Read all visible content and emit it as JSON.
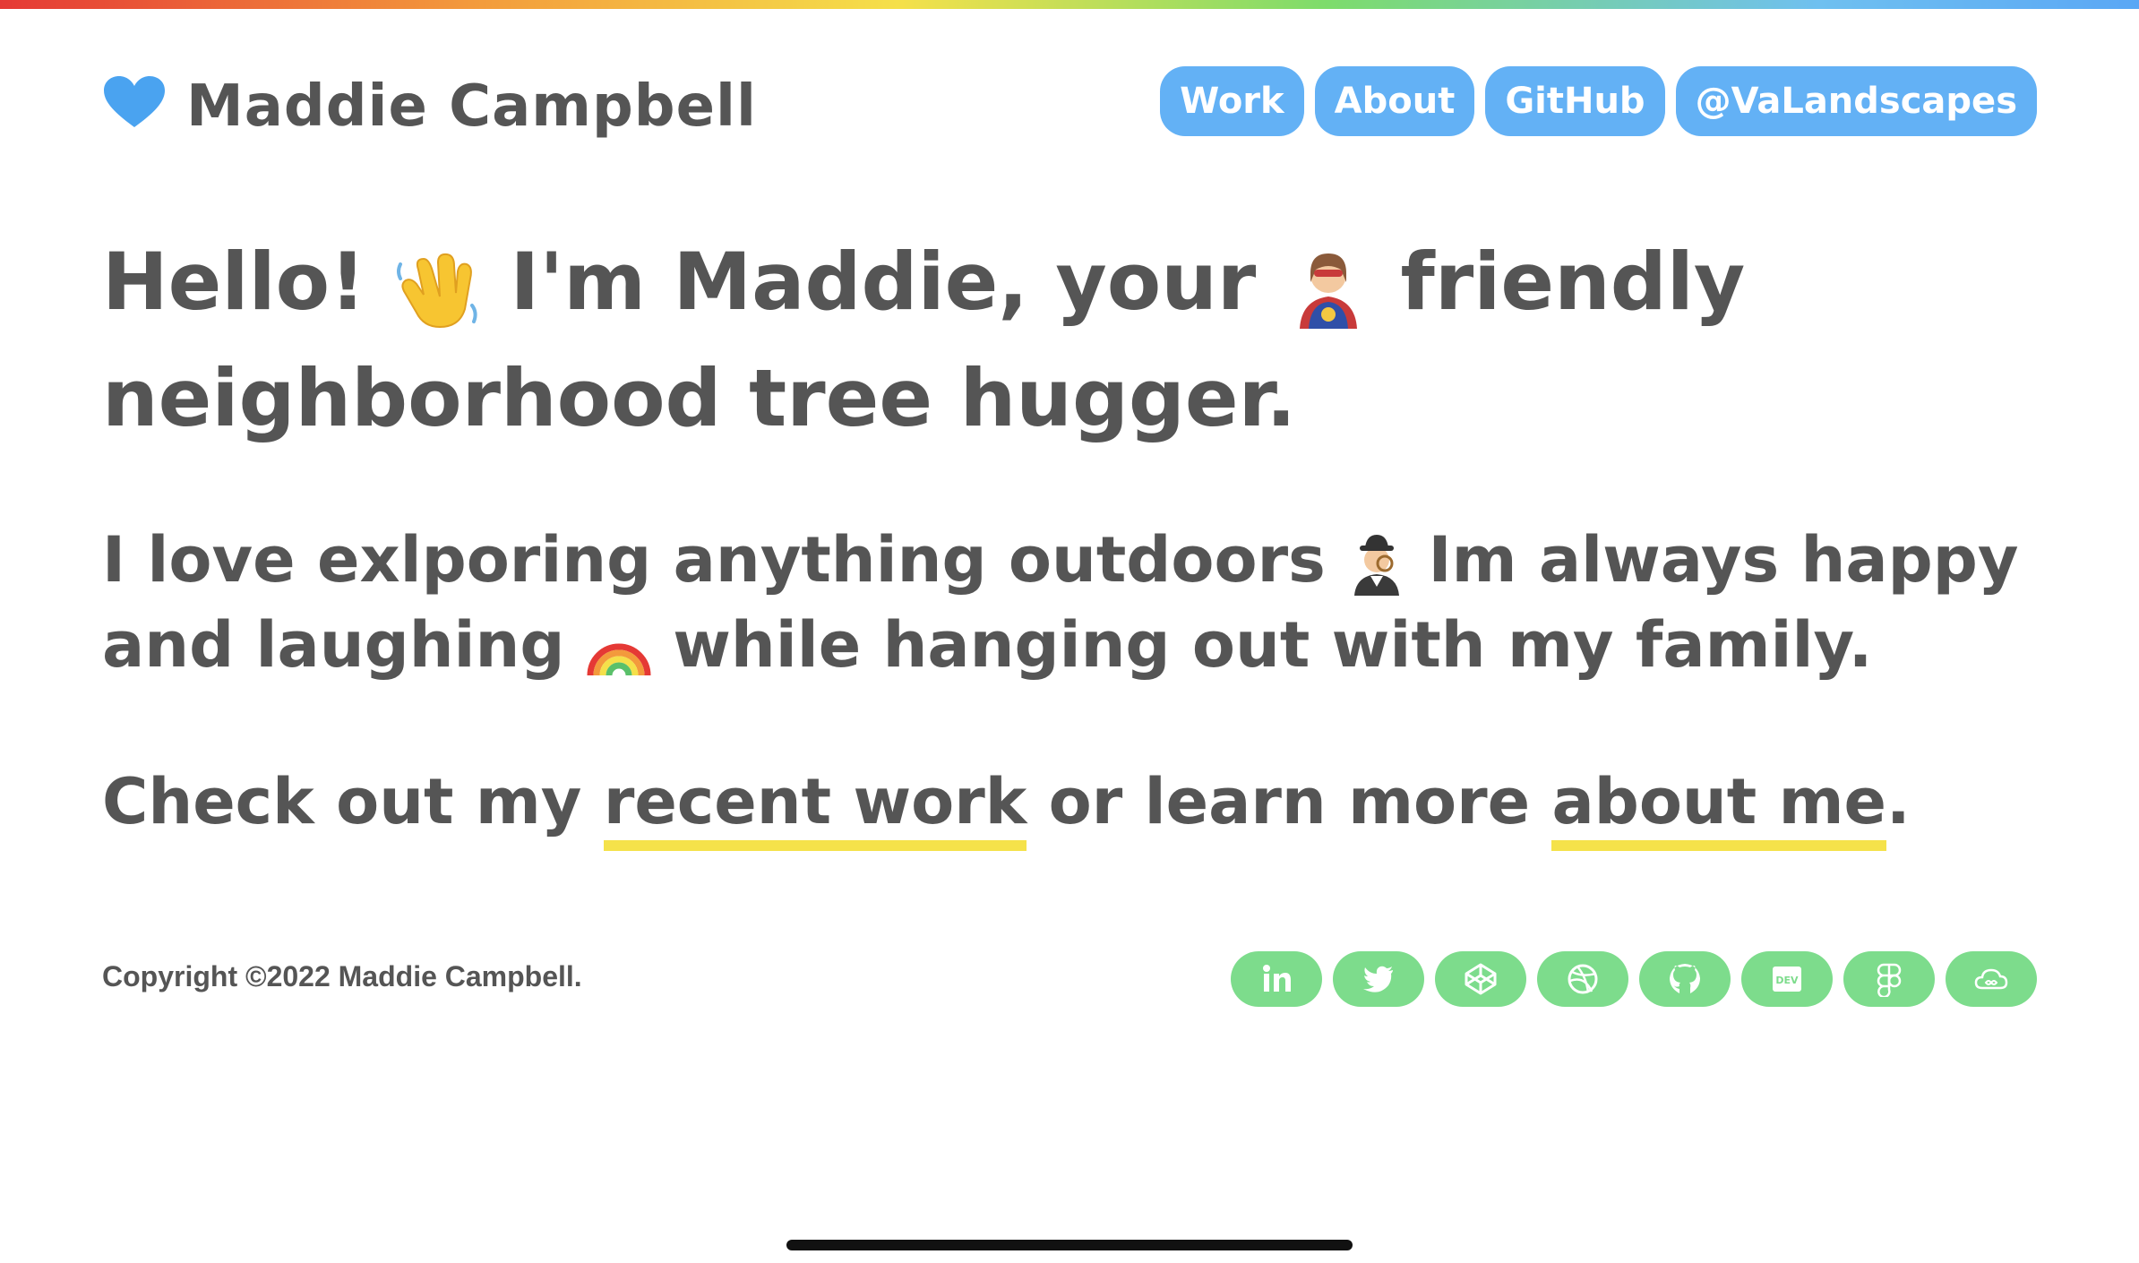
{
  "brand": {
    "name": "Maddie Campbell",
    "icon": "blue-heart-icon",
    "icon_color": "#4aa3f0"
  },
  "nav": {
    "items": [
      {
        "label": "Work"
      },
      {
        "label": "About"
      },
      {
        "label": "GitHub"
      },
      {
        "label": "@VaLandscapes"
      }
    ],
    "pill_color": "#63b1f5"
  },
  "hero": {
    "part1": "Hello!",
    "part2": "I'm Maddie, your",
    "part3": "friendly neighborhood tree hugger.",
    "emoji_1": "waving-hand-icon",
    "emoji_2": "superhero-woman-icon"
  },
  "intro": {
    "part1": "I love exlporing anything outdoors",
    "part2": "Im always happy and laughing",
    "part3": "while hanging out with my family.",
    "emoji_1": "detective-woman-icon",
    "emoji_2": "rainbow-icon"
  },
  "cta": {
    "prefix": "Check out my",
    "work_link": "recent work",
    "middle": "or learn more",
    "about_link": "about me",
    "suffix": ".",
    "underline_color": "#f5e24a"
  },
  "footer": {
    "copyright": "Copyright ©2022 Maddie Campbell.",
    "social_color": "#7ddc8c",
    "socials": [
      {
        "icon": "linkedin-icon"
      },
      {
        "icon": "twitter-icon"
      },
      {
        "icon": "codepen-icon"
      },
      {
        "icon": "dribbble-icon"
      },
      {
        "icon": "github-icon"
      },
      {
        "icon": "dev-icon",
        "label": "DEV"
      },
      {
        "icon": "figma-icon"
      },
      {
        "icon": "cloud-icon"
      }
    ]
  },
  "accent_colors": {
    "text": "#555555",
    "rainbow_bar": [
      "#e53935",
      "#f39a3c",
      "#f5e04a",
      "#7ddc6b",
      "#6fc0f0",
      "#5aa7f5"
    ]
  }
}
